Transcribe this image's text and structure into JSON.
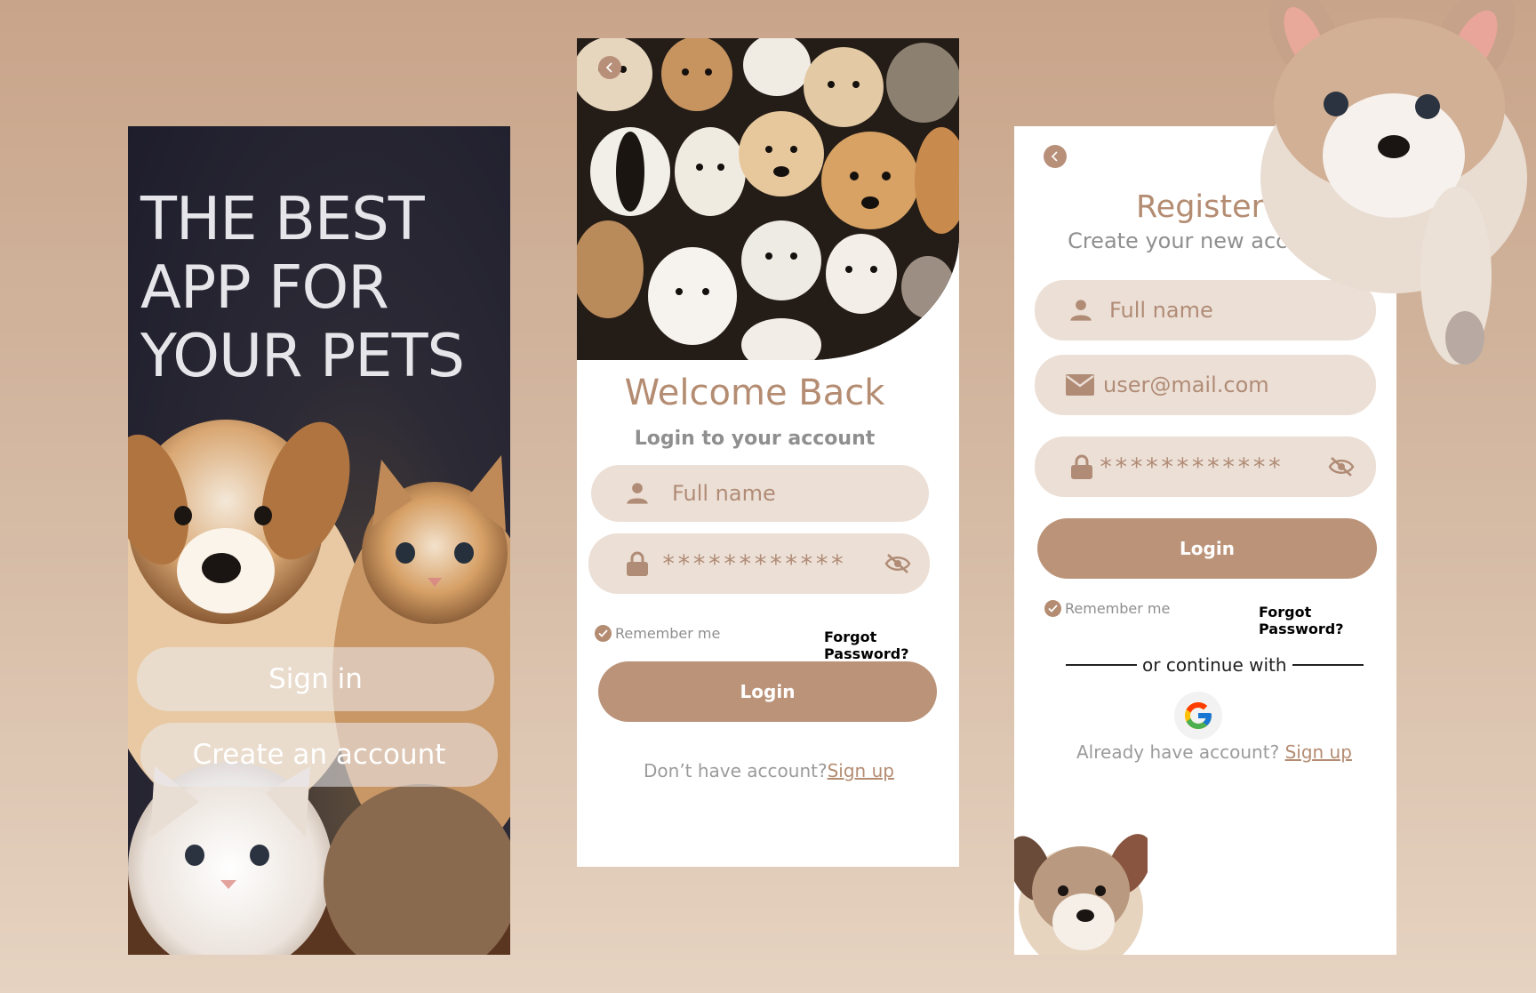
{
  "splash": {
    "headline_lines": [
      "THE BEST",
      "APP FOR",
      "YOUR PETS"
    ],
    "sign_in_label": "Sign in",
    "create_account_label": "Create an account"
  },
  "login": {
    "title": "Welcome Back",
    "subtitle": "Login to your account",
    "name_placeholder": "Full name",
    "password_mask": "************",
    "remember_label": "Remember me",
    "forgot_label": "Forgot Password?",
    "login_button": "Login",
    "footer_text": "Don’t have account?",
    "footer_link": "Sign up"
  },
  "register": {
    "title": "Register",
    "subtitle": "Create your new account",
    "name_placeholder": "Full name",
    "email_placeholder": "user@mail.com",
    "password_mask": "************",
    "login_button": "Login",
    "remember_label": "Remember me",
    "forgot_label": "Forgot Password?",
    "divider_text": "or continue with",
    "footer_text": "Already have account?",
    "footer_link": "Sign up"
  },
  "colors": {
    "accent": "#bb9379",
    "field_bg": "#ecdfd6",
    "page_bg": "#c8a48a",
    "splash_bg": "#1e1d2c"
  },
  "icons": [
    "chevron-left-icon",
    "user-icon",
    "mail-icon",
    "lock-icon",
    "eye-off-icon",
    "check-icon",
    "google-icon"
  ]
}
